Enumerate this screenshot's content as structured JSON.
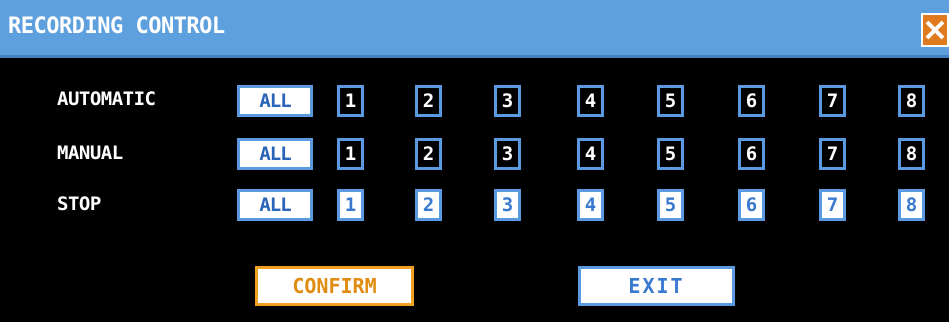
{
  "window": {
    "title": "RECORDING CONTROL",
    "close_icon": "close-icon"
  },
  "colors": {
    "titlebar": "#5e9fdd",
    "accent_blue": "#5a9ae0",
    "confirm_orange": "#f0a020",
    "close_orange": "#e07a1e",
    "background": "#000000"
  },
  "rows": [
    {
      "label": "AUTOMATIC",
      "all": "ALL",
      "channels": [
        "1",
        "2",
        "3",
        "4",
        "5",
        "6",
        "7",
        "8"
      ]
    },
    {
      "label": "MANUAL",
      "all": "ALL",
      "channels": [
        "1",
        "2",
        "3",
        "4",
        "5",
        "6",
        "7",
        "8"
      ]
    },
    {
      "label": "STOP",
      "all": "ALL",
      "channels": [
        "1",
        "2",
        "3",
        "4",
        "5",
        "6",
        "7",
        "8"
      ]
    }
  ],
  "buttons": {
    "confirm": "CONFIRM",
    "exit": "EXIT"
  }
}
